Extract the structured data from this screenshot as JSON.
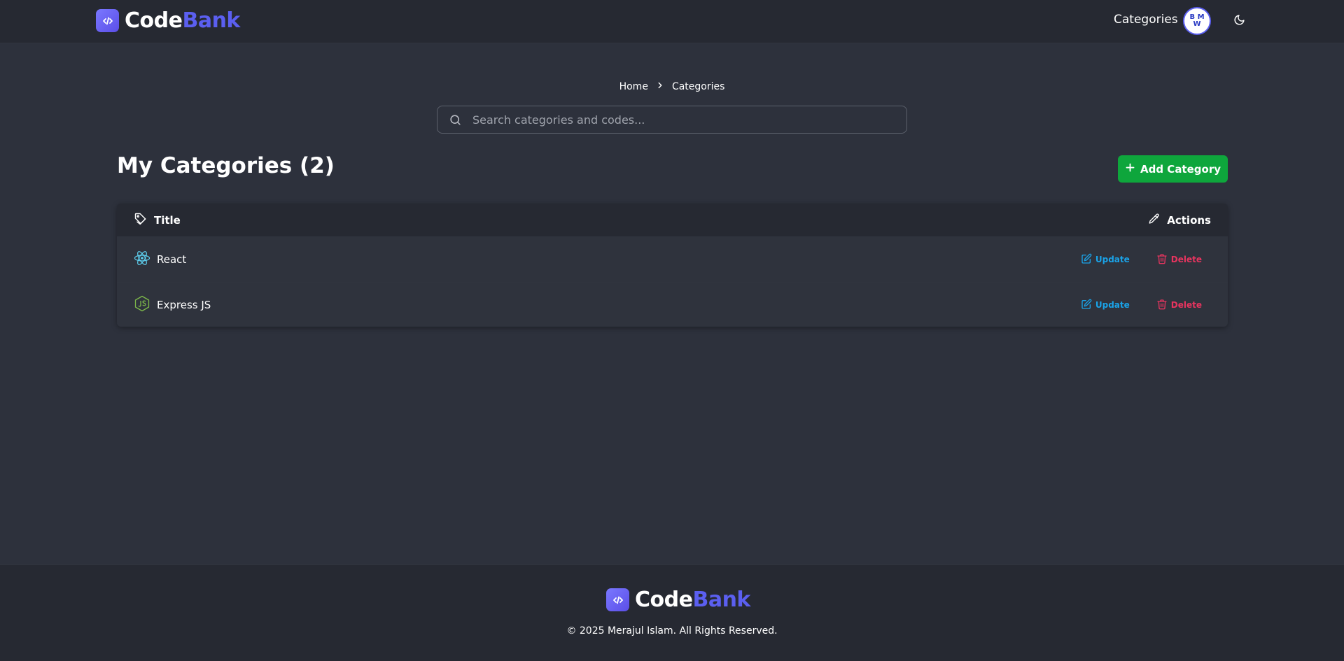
{
  "brand": {
    "code": "Code",
    "bank": "Bank"
  },
  "nav": {
    "categories_link": "Categories",
    "avatar_text": "B M W"
  },
  "breadcrumb": {
    "home": "Home",
    "current": "Categories"
  },
  "search": {
    "placeholder": "Search categories and codes..."
  },
  "page": {
    "title": "My Categories (2)",
    "add_button": "Add Category"
  },
  "table": {
    "headers": {
      "title": "Title",
      "actions": "Actions"
    },
    "rows": [
      {
        "title": "React",
        "icon": "react-icon",
        "update": "Update",
        "delete": "Delete"
      },
      {
        "title": "Express JS",
        "icon": "nodejs-icon",
        "update": "Update",
        "delete": "Delete"
      }
    ]
  },
  "footer": {
    "copyright": "© 2025 Merajul Islam. All Rights Reserved."
  },
  "colors": {
    "background": "#2d313c",
    "navbar": "#262932",
    "accent": "#5b5ff0",
    "add_button": "#0ea63c",
    "update": "#1aa3e8",
    "delete": "#e8345f"
  }
}
